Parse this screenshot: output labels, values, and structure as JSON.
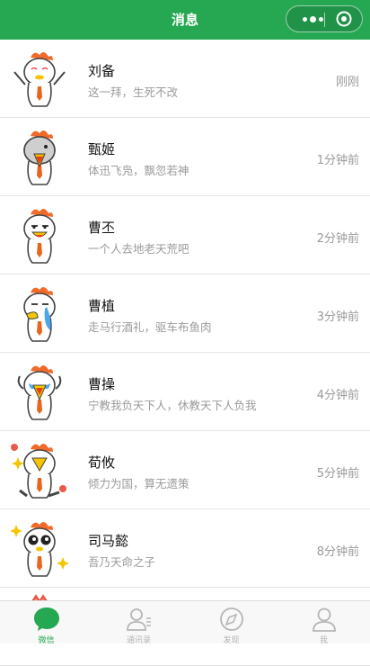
{
  "header": {
    "title": "消息"
  },
  "colors": {
    "brand": "#26a852",
    "text": "#111111",
    "muted": "#9a9a9a"
  },
  "conversations": [
    {
      "name": "刘备",
      "message": "这一拜，生死不改",
      "time": "刚刚",
      "avatar_icon": "chicken-cheer-avatar"
    },
    {
      "name": "甄姬",
      "message": "体迅飞凫，飘忽若神",
      "time": "1分钟前",
      "avatar_icon": "chicken-shout-avatar"
    },
    {
      "name": "曹丕",
      "message": "一个人去地老天荒吧",
      "time": "2分钟前",
      "avatar_icon": "chicken-smug-avatar"
    },
    {
      "name": "曹植",
      "message": "走马行酒礼，驱车布鱼肉",
      "time": "3分钟前",
      "avatar_icon": "chicken-cry-avatar"
    },
    {
      "name": "曹操",
      "message": "宁教我负天下人，休教天下人负我",
      "time": "4分钟前",
      "avatar_icon": "chicken-scream-avatar"
    },
    {
      "name": "荀攸",
      "message": "倾力为国，算无遗策",
      "time": "5分钟前",
      "avatar_icon": "chicken-dance-avatar"
    },
    {
      "name": "司马懿",
      "message": "吾乃天命之子",
      "time": "8分钟前",
      "avatar_icon": "chicken-starry-eyes-avatar"
    }
  ],
  "tabbar": [
    {
      "label": "微信",
      "icon": "chat-icon",
      "active": true
    },
    {
      "label": "通讯录",
      "icon": "contacts-icon",
      "active": false
    },
    {
      "label": "发现",
      "icon": "compass-icon",
      "active": false
    },
    {
      "label": "我",
      "icon": "profile-icon",
      "active": false
    }
  ]
}
